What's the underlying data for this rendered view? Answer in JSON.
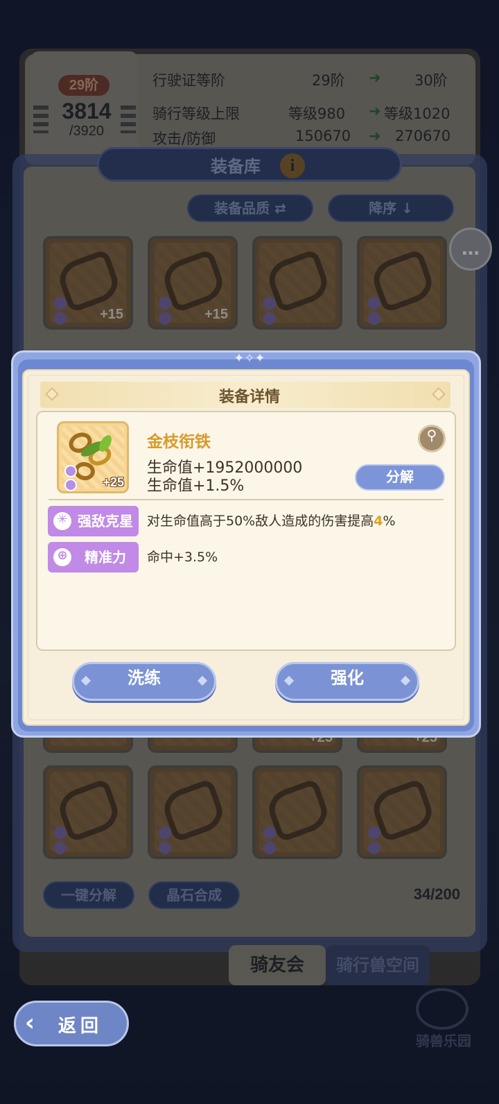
{
  "license": {
    "level_badge": "29阶",
    "current_xp": "3814",
    "max_xp": "/3920",
    "rows": [
      {
        "label": "行驶证等阶",
        "current": "29阶",
        "next": "30阶"
      },
      {
        "label": "骑行等级上限",
        "current": "等级980",
        "next": "等级1020"
      },
      {
        "label": "攻击/防御",
        "current": "150670",
        "next": "270670"
      }
    ]
  },
  "library": {
    "title": "装备库",
    "filter_quality": "装备品质",
    "sort_order": "降序",
    "top_slots": [
      {
        "plus": "+15"
      },
      {
        "plus": "+15"
      },
      {
        "plus": ""
      },
      {
        "plus": ""
      }
    ],
    "bottom_slots": [
      {
        "plus": ""
      },
      {
        "plus": ""
      },
      {
        "plus": ""
      },
      {
        "plus": ""
      }
    ],
    "partial_slots": [
      {
        "plus": ""
      },
      {
        "plus": ""
      },
      {
        "plus": "+25"
      },
      {
        "plus": "+25"
      }
    ],
    "one_click_decompose": "一键分解",
    "crystal_synthesis": "晶石合成",
    "bag_count": "34/200"
  },
  "tabs": {
    "friends": "骑友会",
    "mount_space": "骑行兽空间"
  },
  "nav": {
    "back": "返回",
    "park": "骑兽乐园"
  },
  "modal": {
    "title": "装备详情",
    "item": {
      "name": "金枝衔铁",
      "plus": "+25",
      "stat1": "生命值+1952000000",
      "stat2": "生命值+1.5%"
    },
    "decompose": "分解",
    "tags": [
      {
        "label": "强敌克星",
        "desc_pre": "对生命值高于50%敌人造成的伤害提高",
        "desc_hl": "4",
        "desc_post": "%"
      },
      {
        "label": "精准力",
        "desc_pre": "命中+3.5%",
        "desc_hl": "",
        "desc_post": ""
      }
    ],
    "refine": "洗练",
    "enhance": "强化"
  },
  "colors": {
    "item_name": "#d99a2b",
    "tag_bg": "#c08ae6",
    "button_blue": "#7b93d4",
    "highlight": "#e0a020"
  }
}
